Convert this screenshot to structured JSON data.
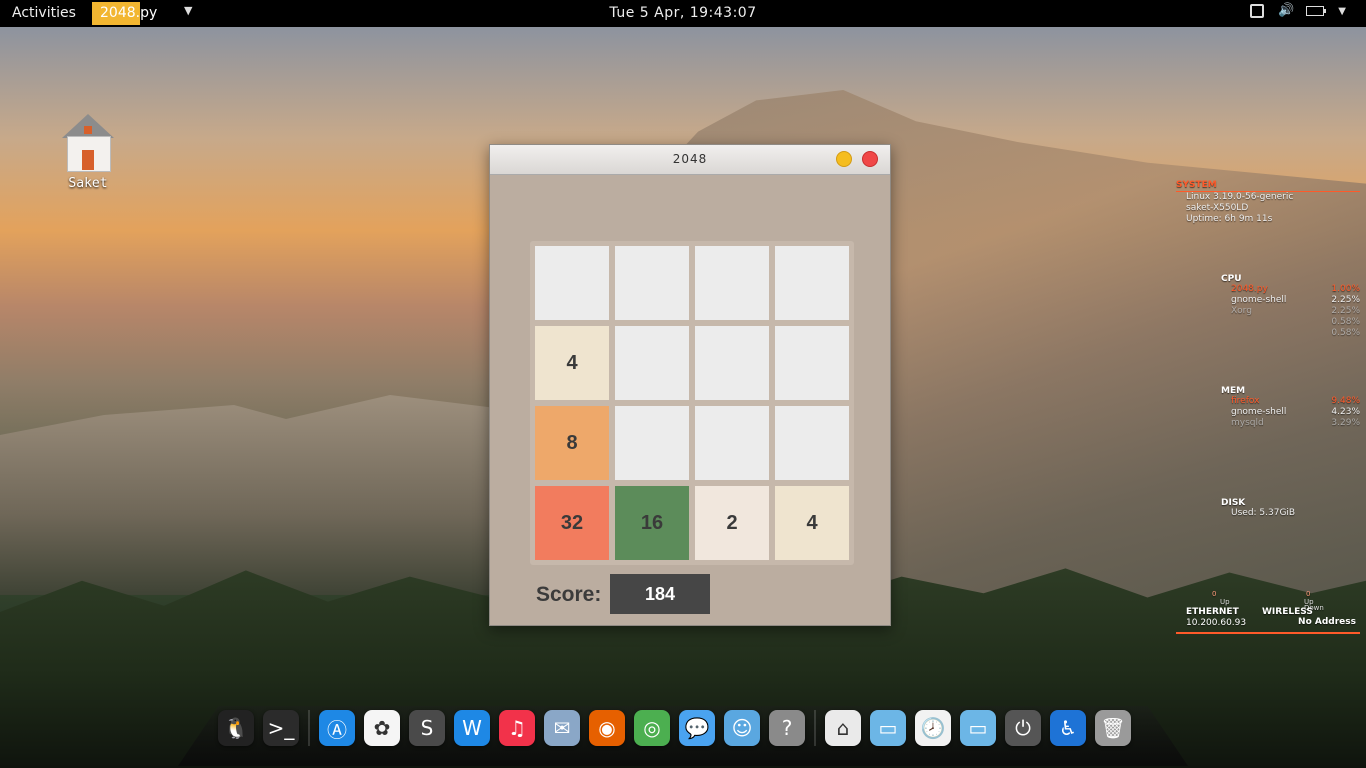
{
  "topbar": {
    "activities": "Activities",
    "app_name": "2048.py",
    "clock": "Tue  5 Apr, 19:43:07"
  },
  "desktop": {
    "icons": [
      {
        "label": "Saket",
        "icon": "home-folder-icon"
      }
    ]
  },
  "window": {
    "title": "2048",
    "tiles": [
      "",
      "",
      "",
      "",
      "4",
      "",
      "",
      "",
      "8",
      "",
      "",
      "",
      "32",
      "16",
      "2",
      "4"
    ],
    "score_label": "Score:",
    "score_value": "184"
  },
  "conky": {
    "system_title": "SYSTEM",
    "system_lines": [
      "Linux 3.19.0-56-generic",
      "saket-X550LD",
      "Uptime: 6h 9m 11s"
    ],
    "cpu_title": "CPU",
    "cpu_processes": [
      {
        "name": "2048.py",
        "value": "1.00%"
      },
      {
        "name": "gnome-shell",
        "value": "2.25%"
      },
      {
        "name": "Xorg",
        "value": "2.25%"
      },
      {
        "name": "",
        "value": "0.58%"
      },
      {
        "name": "",
        "value": "0.58%"
      }
    ],
    "mem_title": "MEM",
    "mem_processes": [
      {
        "name": "firefox",
        "value": "9.48%"
      },
      {
        "name": "gnome-shell",
        "value": "4.23%"
      },
      {
        "name": "mysqld",
        "value": "3.29%"
      }
    ],
    "disk_title": "DISK",
    "disk_used": "Used: 5.37GiB",
    "ethernet_title": "ETHERNET",
    "ethernet_address": "10.200.60.93",
    "wireless_title": "WIRELESS",
    "wireless_address": "No Address",
    "up_label": "Up",
    "down_label": "Down",
    "zero": "0"
  },
  "dock": {
    "items": [
      "tux-icon",
      "terminal-icon",
      "app-store-icon",
      "photos-icon",
      "sublime-text-icon",
      "writer-icon",
      "music-icon",
      "mail-stamp-icon",
      "firefox-icon",
      "chrome-icon",
      "messages-icon",
      "finder-icon",
      "help-icon",
      "home-icon",
      "files-icon",
      "clock-icon",
      "folder-icon",
      "power-icon",
      "accessibility-icon",
      "trash-icon"
    ]
  },
  "colors": {
    "board_bg": "#bbada0",
    "tile_empty": "#ececec",
    "tile_2": "#f1e7dd",
    "tile_4": "#efe4cf",
    "tile_8": "#eea86a",
    "tile_16": "#5c8c5a",
    "tile_32": "#f27c5e",
    "score_box": "#464646",
    "conky_accent": "#ff5a2a"
  }
}
